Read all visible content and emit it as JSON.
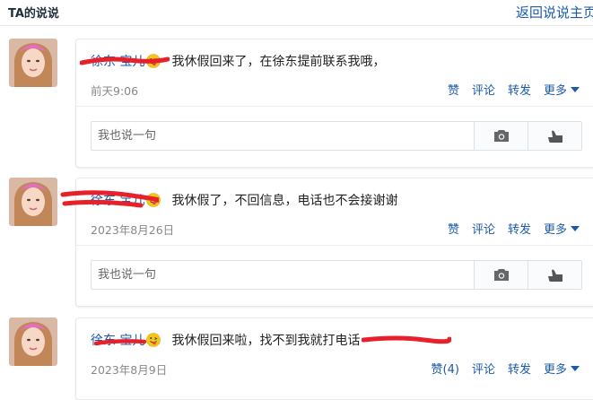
{
  "header": {
    "title": "TA的说说",
    "back_link": "返回说说主页"
  },
  "posts": [
    {
      "author": "徐东 宝儿",
      "content": "我休假回来了，在徐东提前联系我哦，",
      "date": "前天9:06",
      "actions": {
        "like": "赞",
        "comment": "评论",
        "share": "转发",
        "more": "更多"
      },
      "comment_placeholder": "我也说一句"
    },
    {
      "author": "徐东 宝儿",
      "content": "我休假了，不回信息，电话也不会接谢谢",
      "date": "2023年8月26日",
      "actions": {
        "like": "赞",
        "comment": "评论",
        "share": "转发",
        "more": "更多"
      },
      "comment_placeholder": "我也说一句"
    },
    {
      "author": "徐东 宝儿",
      "content": "我休假回来啦，找不到我就打电话",
      "date": "2023年8月9日",
      "actions": {
        "like": "赞(4)",
        "comment": "评论",
        "share": "转发",
        "more": "更多"
      }
    }
  ],
  "icons": {
    "emoji": "tongue-out-emoji-icon",
    "camera": "camera-icon",
    "like": "thumbs-up-icon",
    "caret": "caret-down-icon"
  },
  "colors": {
    "link": "#1a5aa8",
    "redaction": "#e8202a",
    "emoji": "#f5c518"
  }
}
